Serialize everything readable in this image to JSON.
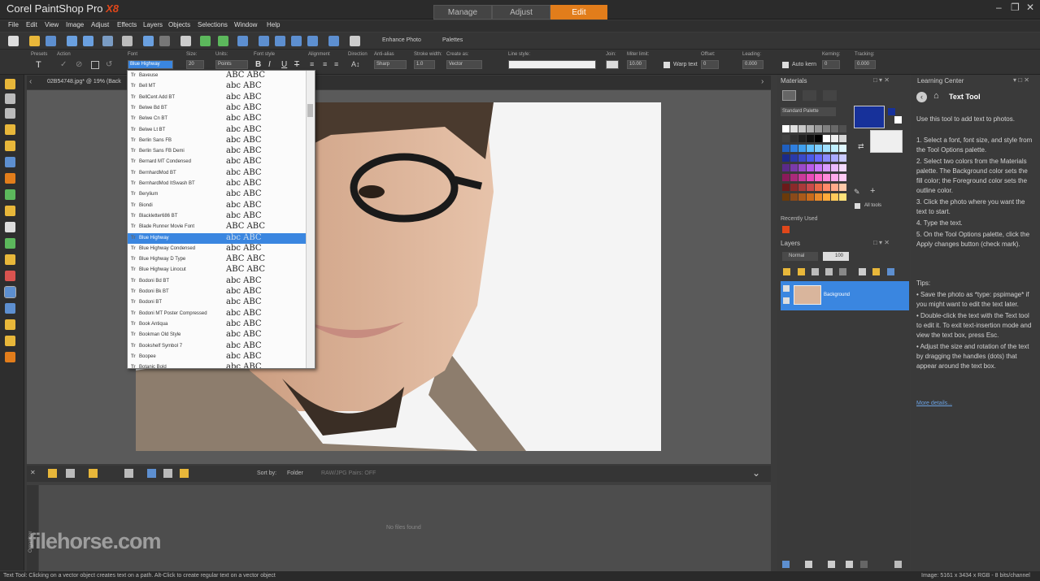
{
  "title": {
    "app": "Corel PaintShop Pro",
    "version": "X8"
  },
  "mode_tabs": [
    "Manage",
    "Adjust",
    "Edit"
  ],
  "active_mode": "Edit",
  "menu": [
    "File",
    "Edit",
    "View",
    "Image",
    "Adjust",
    "Effects",
    "Layers",
    "Objects",
    "Selections",
    "Window",
    "Help"
  ],
  "toolbar": {
    "enhance_photo": "Enhance Photo",
    "palettes": "Palettes"
  },
  "tool_options": {
    "presets": "Presets",
    "action": "Action",
    "font_label": "Font",
    "font_value": "Blue Highway",
    "size_label": "Size:",
    "size_value": "20",
    "units_label": "Units:",
    "units_value": "Points",
    "font_style_label": "Font style",
    "alignment_label": "Alignment",
    "direction_label": "Direction",
    "anti_alias_label": "Anti-alias",
    "anti_alias_value": "Sharp",
    "stroke_width_label": "Stroke width:",
    "stroke_width_value": "1.0",
    "create_as_label": "Create as:",
    "create_as_value": "Vector",
    "line_style_label": "Line style:",
    "join_label": "Join:",
    "miter_limit_label": "Miter limit:",
    "miter_limit_value": "10.00",
    "warp_text": "Warp text",
    "offset_label": "Offset:",
    "offset_value": "0",
    "leading_label": "Leading:",
    "leading_value": "0.000",
    "auto_kern": "Auto kern",
    "kerning_label": "Kerning:",
    "kerning_value": "0",
    "tracking_label": "Tracking:",
    "tracking_value": "0.000"
  },
  "document_tab": "02B54748.jpg* @ 19% (Back",
  "font_list": [
    {
      "name": "Baveuse",
      "sample": "ABC ABC"
    },
    {
      "name": "Bell MT",
      "sample": "abc ABC"
    },
    {
      "name": "BellCent Add BT",
      "sample": "abc ABC"
    },
    {
      "name": "Belwe Bd BT",
      "sample": "abc ABC"
    },
    {
      "name": "Belwe Cn BT",
      "sample": "abc ABC"
    },
    {
      "name": "Belwe Lt BT",
      "sample": "abc ABC"
    },
    {
      "name": "Berlin Sans FB",
      "sample": "abc ABC"
    },
    {
      "name": "Berlin Sans FB Demi",
      "sample": "abc ABC"
    },
    {
      "name": "Bernard MT Condensed",
      "sample": "abc ABC"
    },
    {
      "name": "BernhardMod BT",
      "sample": "abc ABC"
    },
    {
      "name": "BernhardMod ItSwash BT",
      "sample": "abc ABC"
    },
    {
      "name": "Berylium",
      "sample": "abc ABC"
    },
    {
      "name": "Biondi",
      "sample": "abc ABC"
    },
    {
      "name": "Blackletter686 BT",
      "sample": "abc ABC"
    },
    {
      "name": "Blade Runner Movie Font",
      "sample": "ABC ABC"
    },
    {
      "name": "Blue Highway",
      "sample": "abc ABC"
    },
    {
      "name": "Blue Highway Condensed",
      "sample": "abc ABC"
    },
    {
      "name": "Blue Highway D Type",
      "sample": "ABC ABC"
    },
    {
      "name": "Blue Highway Linocut",
      "sample": "ABC ABC"
    },
    {
      "name": "Bodoni Bd BT",
      "sample": "abc ABC"
    },
    {
      "name": "Bodoni Bk BT",
      "sample": "abc ABC"
    },
    {
      "name": "Bodoni BT",
      "sample": "abc ABC"
    },
    {
      "name": "Bodoni MT Poster Compressed",
      "sample": "abc ABC"
    },
    {
      "name": "Book Antiqua",
      "sample": "abc ABC"
    },
    {
      "name": "Bookman Old Style",
      "sample": "abc ABC"
    },
    {
      "name": "Bookshelf Symbol 7",
      "sample": "abc ABC"
    },
    {
      "name": "Boopee",
      "sample": "abc ABC"
    },
    {
      "name": "Botanic Bold",
      "sample": "abc ABC"
    }
  ],
  "selected_font": "Blue Highway",
  "organizer": {
    "sort_by": "Sort by:",
    "sort_value": "Folder",
    "raw_jpg": "RAW/JPG Pairs: OFF",
    "no_files": "No files found",
    "side_label": "Organizer"
  },
  "watermark": "filehorse.com",
  "status": {
    "left": "Text Tool: Clicking on a vector object creates text on a path. Alt-Click to create regular text on a vector object",
    "right": "Image: 5161 x 3434 x RGB - 8 bits/channel"
  },
  "materials": {
    "title": "Materials",
    "palette_select": "Standard Palette",
    "all_tools": "All tools",
    "recently_used": "Recently Used"
  },
  "layers": {
    "title": "Layers",
    "blend_mode": "Normal",
    "opacity": "100",
    "layer_name": "Background"
  },
  "learning_center": {
    "title": "Learning Center",
    "tool_title": "Text Tool",
    "intro": "Use this tool to add text to photos.",
    "steps": [
      "1. Select a font, font size, and style from the Tool Options palette.",
      "2. Select two colors from the Materials palette. The Background color sets the fill color; the Foreground color sets the outline color.",
      "3. Click the photo where you want the text to start.",
      "4. Type the text.",
      "5. On the Tool Options palette, click the Apply changes button (check mark)."
    ],
    "tips_title": "Tips:",
    "tips": [
      "Save the photo as *type: pspimage* if you might want to edit the text later.",
      "Double-click the text with the Text tool to edit it. To exit text-insertion mode and view the text box, press Esc.",
      "Adjust the size and rotation of the text by dragging the handles (dots) that appear around the text box."
    ],
    "more_details": "More details..."
  },
  "colors": {
    "accent": "#e27d1b",
    "selection": "#3a86e0",
    "foreground": "#17319a"
  }
}
